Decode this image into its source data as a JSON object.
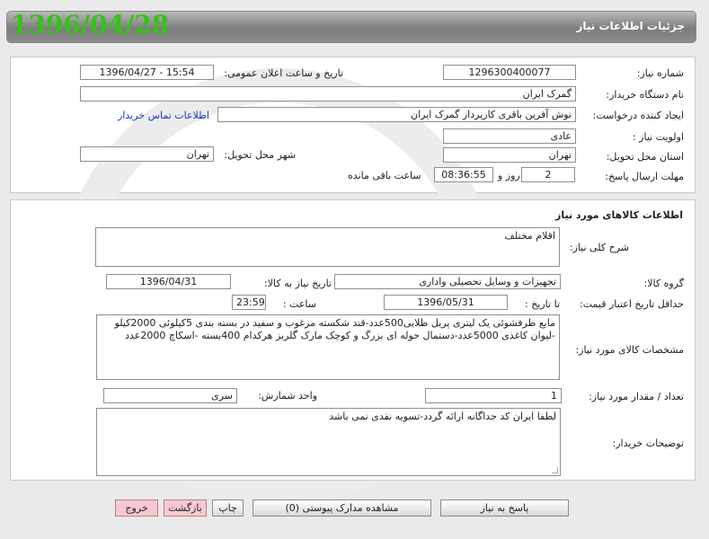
{
  "header": {
    "title": "جزئیات اطلاعات نیاز",
    "date_stamp": "1396/04/28"
  },
  "need_info": {
    "need_number_label": "شماره نیاز:",
    "need_number": "1296300400077",
    "announce_label": "تاریخ و ساعت اعلان عمومی:",
    "announce_value": "1396/04/27 - 15:54",
    "buyer_org_label": "نام دستگاه خریدار:",
    "buyer_org": "گمرک ایران",
    "requester_label": "ایجاد کننده درخواست:",
    "requester": "نوش آفرین باقری کارپرداز گمرک ایران",
    "contact_link": "اطلاعات تماس خریدار",
    "priority_label": "اولویت نیاز :",
    "priority": "عادی",
    "province_label": "استان محل تحویل:",
    "province": "تهران",
    "city_label": "شهر محل تحویل:",
    "city": "تهران",
    "deadline_label": "مهلت ارسال پاسخ:",
    "deadline_days": "2",
    "days_and": "روز و",
    "deadline_time": "08:36:55",
    "remaining": "ساعت باقی مانده"
  },
  "goods": {
    "section_title": "اطلاعات کالاهای مورد نیاز",
    "summary_label": "شرح کلی نیاز:",
    "summary": "اقلام مختلف",
    "group_label": "گروه کالا:",
    "group": "تجهیزات و وسایل تحصیلی واداری",
    "need_date_label": "تاریخ نیاز به کالا:",
    "need_date": "1396/04/31",
    "validity_label": "حداقل تاریخ اعتبار قیمت:",
    "until_label": "تا تاریخ :",
    "validity_date": "1396/05/31",
    "time_label": "ساعت :",
    "validity_time": "23:59",
    "specs_label": "مشخصات کالای مورد نیاز:",
    "specs": "مایع ظرفشوئی یک لیتری پریل طلایی500عدد-قند شکسته مرغوب و سفید  در بسته بندی 5کیلوئی 2000کیلو -لیوان کاغذی 5000عدد-دستمال حوله ای بزرگ و کوچک مارک گلریز هرکدام 400بسته -اسکاچ 2000عدد",
    "qty_label": "تعداد / مقدار مورد نیاز:",
    "qty": "1",
    "unit_label": "واحد شمارش:",
    "unit": "سری",
    "notes_label": "توضیحات خریدار:",
    "notes": "لطفا ایران کد جداگانه ارائه گردد-تسویه نقدی نمی باشد"
  },
  "actions": {
    "reply": "پاسخ به نیاز",
    "attachments": "مشاهده مدارک پیوستی (0)",
    "print": "چاپ",
    "back": "بازگشت",
    "exit": "خروج"
  },
  "colors": {
    "date_stamp": "#36c21a",
    "link": "#1538c7",
    "pink_button": "#f7c9cf"
  }
}
